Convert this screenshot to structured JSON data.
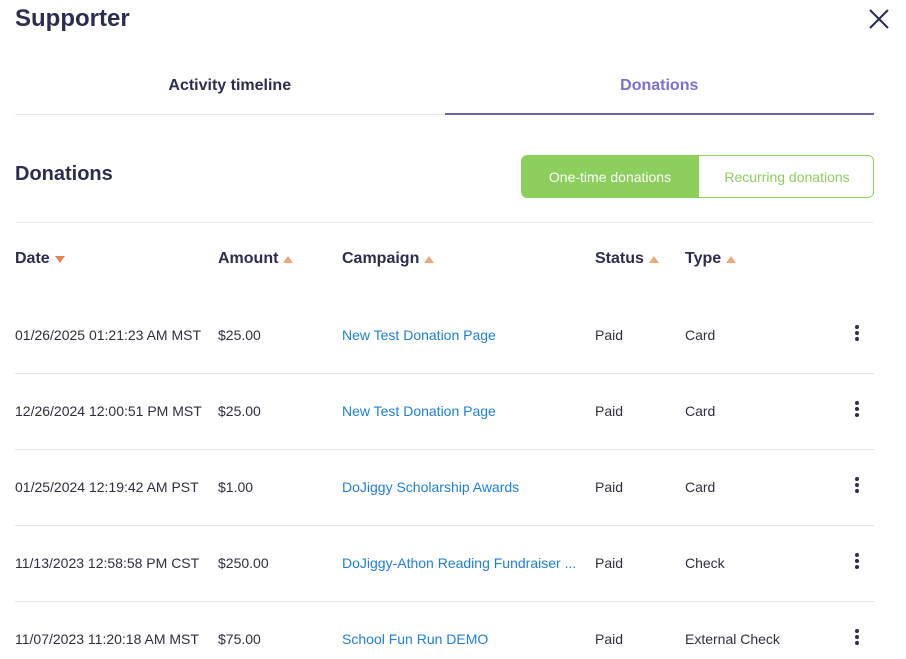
{
  "panel": {
    "title": "Supporter"
  },
  "tabs": [
    {
      "label": "Activity timeline",
      "active": false
    },
    {
      "label": "Donations",
      "active": true
    }
  ],
  "section": {
    "title": "Donations",
    "toggle": {
      "one_time": "One-time donations",
      "recurring": "Recurring donations",
      "selected": "One-time donations"
    }
  },
  "table": {
    "columns": [
      {
        "label": "Date",
        "sort": "desc"
      },
      {
        "label": "Amount",
        "sort": "asc"
      },
      {
        "label": "Campaign",
        "sort": "asc"
      },
      {
        "label": "Status",
        "sort": "asc"
      },
      {
        "label": "Type",
        "sort": "asc"
      }
    ],
    "rows": [
      {
        "date": "01/26/2025 01:21:23 AM MST",
        "amount": "$25.00",
        "campaign": "New Test Donation Page",
        "status": "Paid",
        "type": "Card"
      },
      {
        "date": "12/26/2024 12:00:51 PM MST",
        "amount": "$25.00",
        "campaign": "New Test Donation Page",
        "status": "Paid",
        "type": "Card"
      },
      {
        "date": "01/25/2024 12:19:42 AM PST",
        "amount": "$1.00",
        "campaign": "DoJiggy Scholarship Awards",
        "status": "Paid",
        "type": "Card"
      },
      {
        "date": "11/13/2023 12:58:58 PM CST",
        "amount": "$250.00",
        "campaign": "DoJiggy-Athon Reading Fundraiser ...",
        "status": "Paid",
        "type": "Check"
      },
      {
        "date": "11/07/2023 11:20:18 AM MST",
        "amount": "$75.00",
        "campaign": "School Fun Run DEMO",
        "status": "Paid",
        "type": "External Check"
      }
    ]
  },
  "colors": {
    "accent_purple": "#7b6fd1",
    "toggle_green": "#8ccf5c",
    "link_blue": "#1e7fd6",
    "sort_arrow": "#e0864a",
    "heading": "#2b2d4f"
  },
  "icons": {
    "close": "close-icon",
    "row_menu": "more-vertical-icon"
  }
}
